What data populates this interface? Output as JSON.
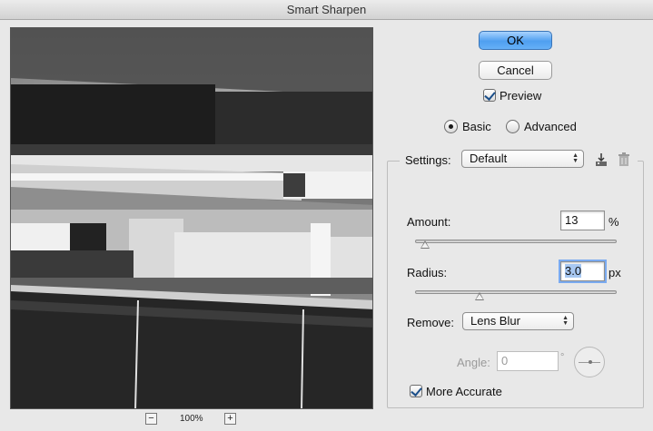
{
  "window": {
    "title": "Smart Sharpen"
  },
  "preview": {
    "zoom_label": "100%",
    "zoom_out_icon": "minus-icon",
    "zoom_in_icon": "plus-icon"
  },
  "buttons": {
    "ok_label": "OK",
    "cancel_label": "Cancel"
  },
  "preview_option": {
    "label": "Preview",
    "checked": true
  },
  "mode": {
    "basic_label": "Basic",
    "advanced_label": "Advanced",
    "selected": "Basic"
  },
  "settings": {
    "label": "Settings:",
    "value": "Default",
    "save_icon": "save-settings-icon",
    "delete_icon": "trash-icon"
  },
  "amount": {
    "label": "Amount:",
    "value": "13",
    "unit": "%",
    "slider_fraction": 0.03
  },
  "radius": {
    "label": "Radius:",
    "value": "3.0",
    "unit": "px",
    "slider_fraction": 0.31
  },
  "remove": {
    "label": "Remove:",
    "value": "Lens Blur"
  },
  "angle": {
    "label": "Angle:",
    "value": "0",
    "unit": "°",
    "enabled": false
  },
  "more_accurate": {
    "label": "More Accurate",
    "checked": true
  },
  "colors": {
    "ok_button": "#4f9ff0",
    "focus_ring": "#7aaaf0",
    "dialog_bg": "#e8e8e8"
  }
}
